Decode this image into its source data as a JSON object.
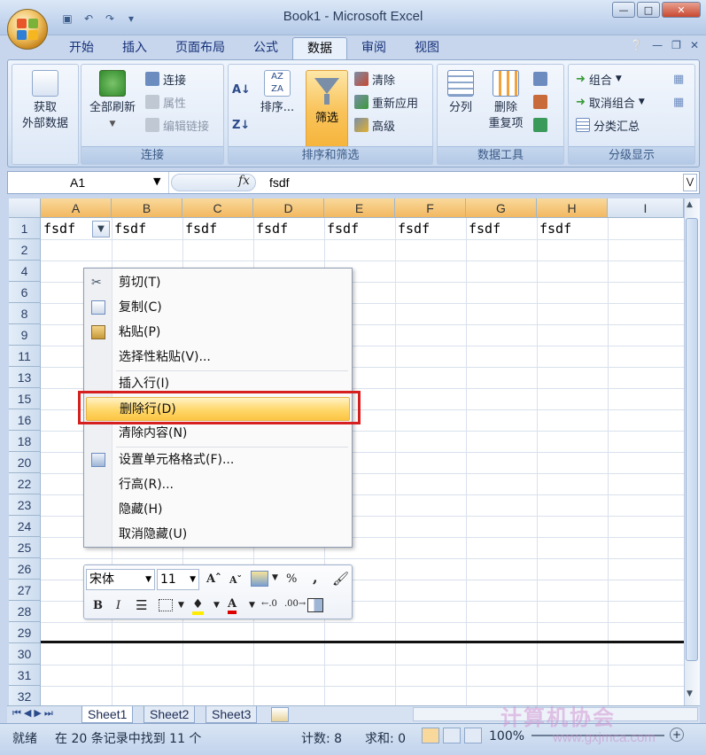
{
  "window": {
    "title": "Book1 - Microsoft Excel"
  },
  "ribbon_tabs": [
    "开始",
    "插入",
    "页面布局",
    "公式",
    "数据",
    "审阅",
    "视图"
  ],
  "active_tab": "数据",
  "ribbon": {
    "get_external": {
      "line1": "获取",
      "line2": "外部数据"
    },
    "refresh_all": "全部刷新",
    "connections": "连接",
    "properties": "属性",
    "edit_links": "编辑链接",
    "group_connections": "连接",
    "sort": "排序...",
    "filter": "筛选",
    "clear": "清除",
    "reapply": "重新应用",
    "advanced": "高级",
    "group_sort_filter": "排序和筛选",
    "text_to_columns": "分列",
    "remove_duplicates_1": "删除",
    "remove_duplicates_2": "重复项",
    "group_data_tools": "数据工具",
    "group_btn": "组合",
    "ungroup": "取消组合",
    "subtotal": "分类汇总",
    "group_outline": "分级显示"
  },
  "formula_bar": {
    "name_box": "A1",
    "fx": "fx",
    "value": "fsdf"
  },
  "columns": [
    "A",
    "B",
    "C",
    "D",
    "E",
    "F",
    "G",
    "H",
    "I"
  ],
  "rows": [
    "1",
    "2",
    "4",
    "6",
    "8",
    "9",
    "11",
    "13",
    "15",
    "16",
    "18",
    "20",
    "22",
    "23",
    "24",
    "25",
    "26",
    "27",
    "28",
    "29",
    "30",
    "31",
    "32"
  ],
  "row1_values": [
    "fsdf",
    "fsdf",
    "fsdf",
    "fsdf",
    "fsdf",
    "fsdf",
    "fsdf",
    "fsdf"
  ],
  "context_menu": {
    "cut": "剪切(T)",
    "copy": "复制(C)",
    "paste": "粘贴(P)",
    "paste_special": "选择性粘贴(V)...",
    "insert_row": "插入行(I)",
    "delete_row": "删除行(D)",
    "clear_contents": "清除内容(N)",
    "format_cells": "设置单元格格式(F)...",
    "row_height": "行高(R)...",
    "hide": "隐藏(H)",
    "unhide": "取消隐藏(U)"
  },
  "mini_toolbar": {
    "font": "宋体",
    "size": "11"
  },
  "sheets": [
    "Sheet1",
    "Sheet2",
    "Sheet3"
  ],
  "status": {
    "ready": "就绪",
    "filter_msg": "在 20 条记录中找到 11 个",
    "count": "计数: 8",
    "sum": "求和: 0",
    "zoom": "100%"
  },
  "watermark": {
    "text": "计算机协会",
    "url": "www.gxjmca.com"
  },
  "colors": {
    "selected_header": "#f6c36a",
    "highlight": "#ffd76a",
    "red_box": "#d61f1f"
  }
}
